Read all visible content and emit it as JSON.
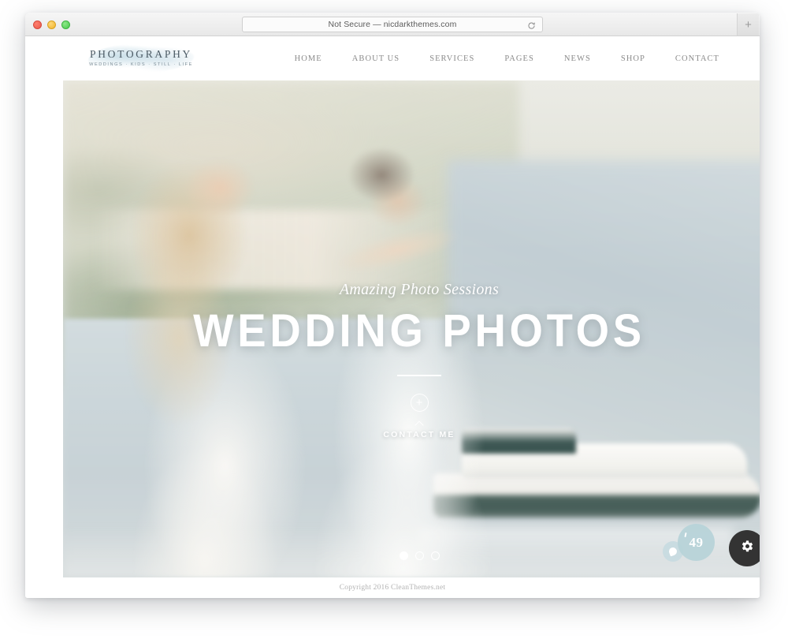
{
  "browser": {
    "url_text": "Not Secure — nicdarkthemes.com",
    "reload_icon": "reload-icon",
    "new_tab_label": "+",
    "traffic_lights": [
      "close",
      "minimize",
      "maximize"
    ]
  },
  "site": {
    "logo": {
      "title": "PHOTOGRAPHY",
      "tagline": "WEDDINGS  ·  KIDS  ·  STILL  ·  LIFE"
    },
    "nav": [
      {
        "label": "HOME"
      },
      {
        "label": "ABOUT US"
      },
      {
        "label": "SERVICES"
      },
      {
        "label": "PAGES"
      },
      {
        "label": "NEWS"
      },
      {
        "label": "SHOP"
      },
      {
        "label": "CONTACT"
      }
    ],
    "hero": {
      "subtitle": "Amazing Photo Sessions",
      "title": "WEDDING PHOTOS",
      "plus_label": "+",
      "cta_label": "CONTACT ME",
      "slides": [
        {
          "active": true
        },
        {
          "active": false
        },
        {
          "active": false
        }
      ]
    },
    "widgets": {
      "bubble_count": "49",
      "gear_icon": "gear-icon"
    },
    "footer": {
      "copyright": "Copyright 2016 CleanThemes.net"
    }
  },
  "colors": {
    "logo_text": "#4b5a64",
    "logo_blob": "#b0d0de",
    "nav_text": "#8b8b8b",
    "hero_text": "#ffffff",
    "bubble": "#b6d2d8",
    "gear_button": "#333333",
    "footer_text": "#b3b3b3"
  }
}
